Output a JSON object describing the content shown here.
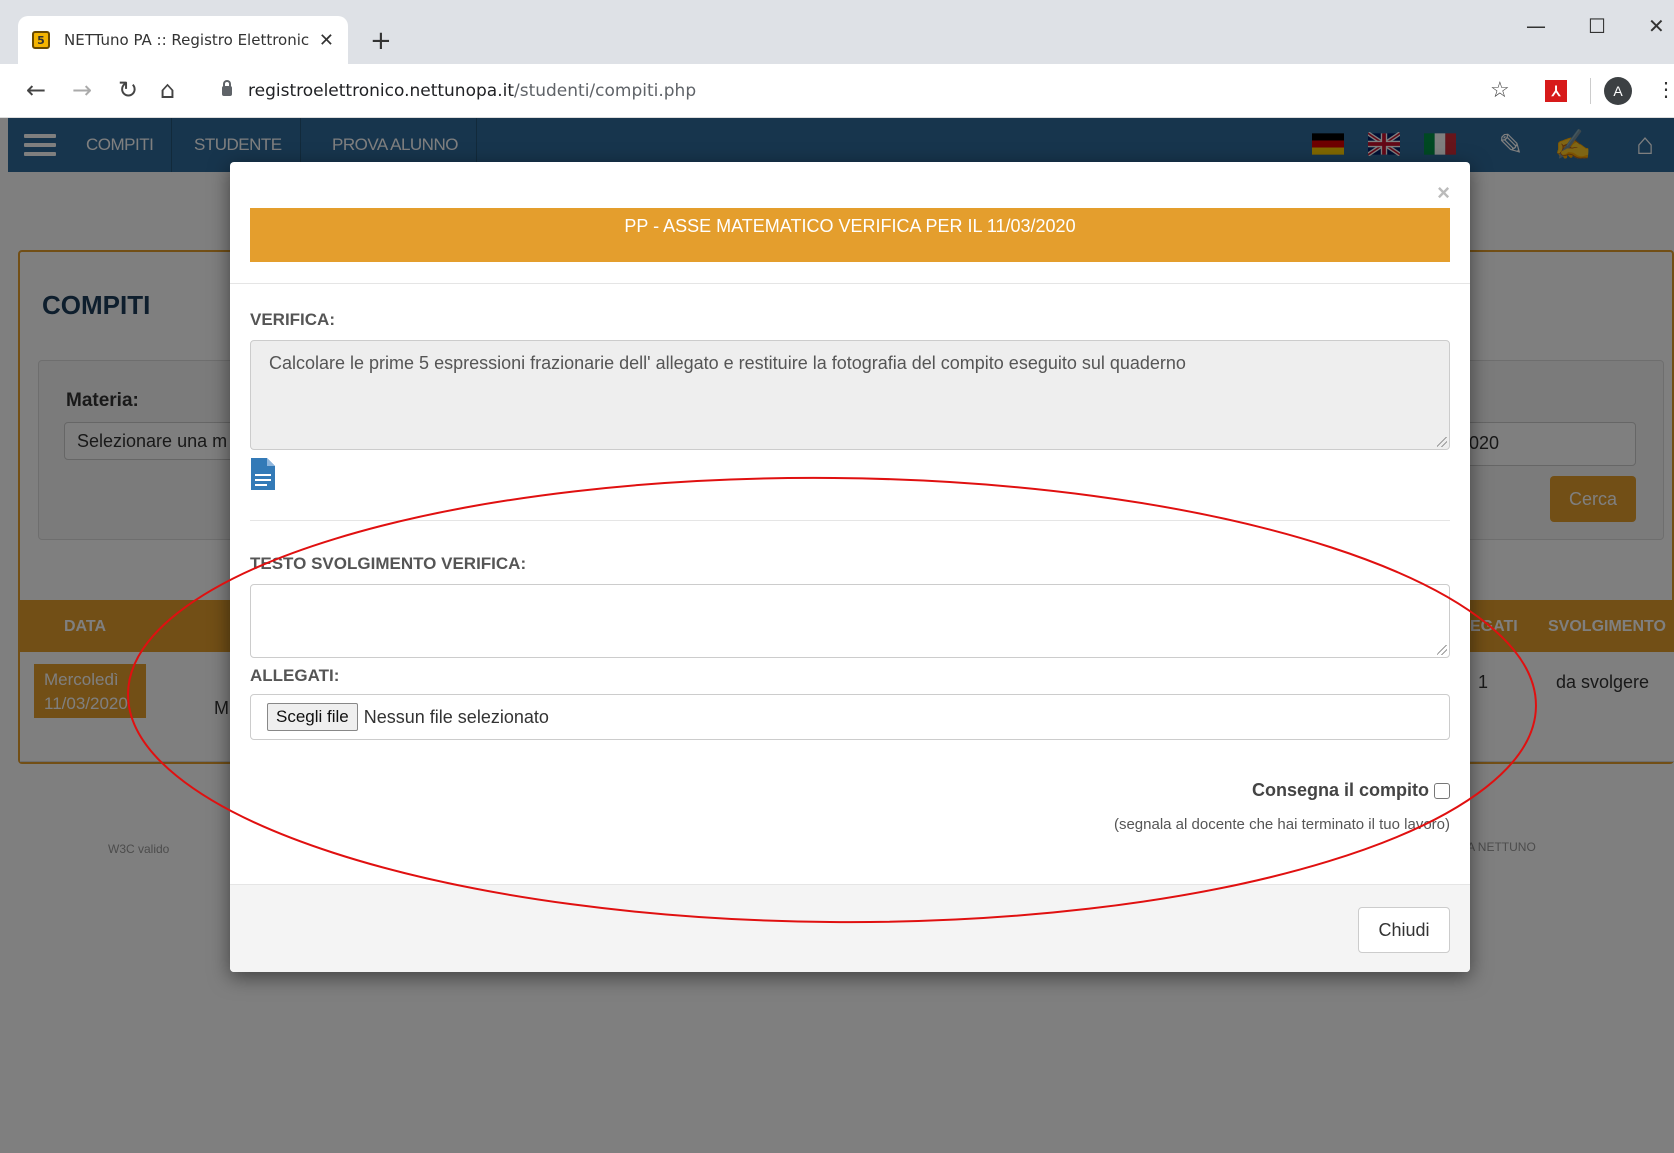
{
  "browser": {
    "tab_title": "NETTuno PA :: Registro Elettronic",
    "favicon_letter": "5",
    "url_host": "registroelettronico.nettunopa.it",
    "url_path": "/studenti/compiti.php",
    "profile_initial": "A"
  },
  "nav": {
    "items": [
      "COMPITI",
      "STUDENTE",
      "PROVA ALUNNO"
    ]
  },
  "page": {
    "title": "COMPITI",
    "materia_label": "Materia:",
    "materia_value": "Selezionare una m",
    "date_value": "020",
    "cerca_label": "Cerca",
    "table_headers": [
      "DATA",
      "EGATI",
      "SVOLGIMENTO"
    ],
    "row": {
      "day": "Mercoledì",
      "date": "11/03/2020",
      "fragment": "M",
      "allegati": "1",
      "svolgimento": "da svolgere"
    },
    "footer_w3c": "W3C valido",
    "footer_brand": "PA  NETTUNO"
  },
  "modal": {
    "close_symbol": "×",
    "banner": "PP - ASSE MATEMATICO VERIFICA PER IL 11/03/2020",
    "verifica_label": "VERIFICA:",
    "verifica_text": "Calcolare le prime 5 espressioni frazionarie dell' allegato e restituire la fotografia del compito eseguito sul quaderno",
    "testo_label": "TESTO SVOLGIMENTO VERIFICA:",
    "testo_value": "",
    "allegati_label": "ALLEGATI:",
    "file_button": "Scegli file",
    "file_status": "Nessun file selezionato",
    "consegna_label": "Consegna il compito",
    "consegna_checked": false,
    "consegna_note": "(segnala al docente che hai terminato il tuo lavoro)",
    "chiudi_label": "Chiudi"
  },
  "colors": {
    "accent": "#e49e2d",
    "navbar": "#2f6a9a",
    "annotation": "#e01010"
  }
}
